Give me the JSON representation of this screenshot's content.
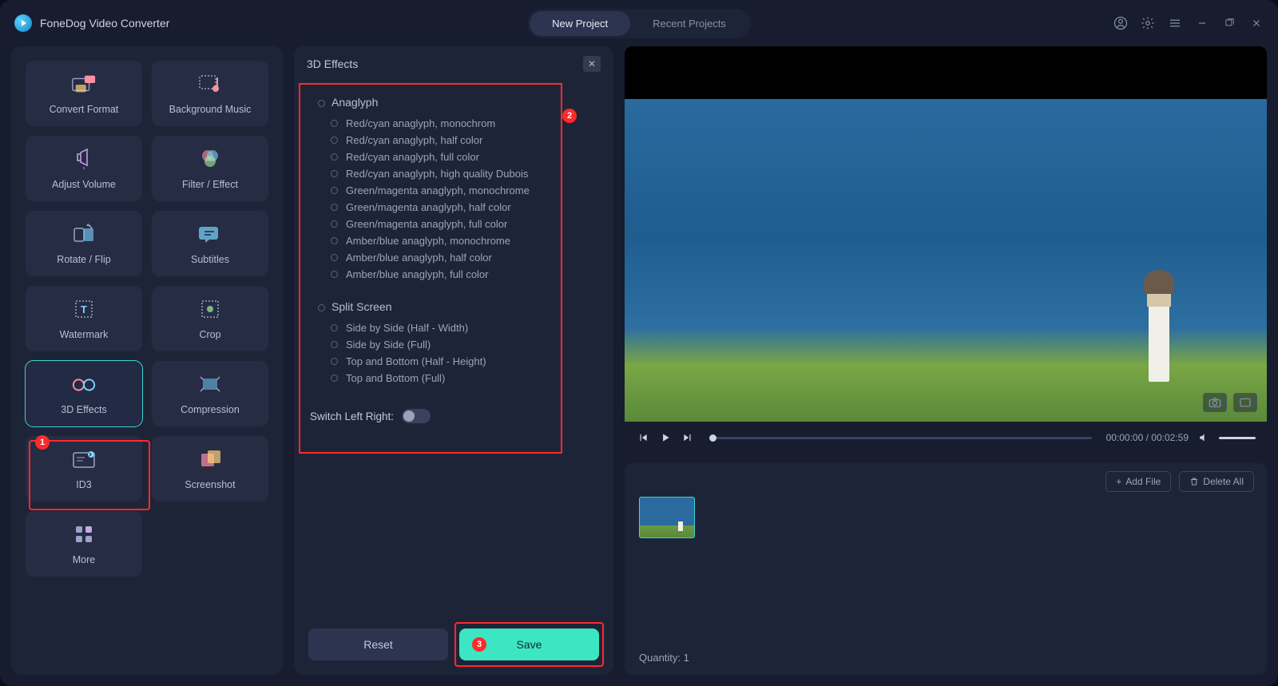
{
  "app_title": "FoneDog Video Converter",
  "tabs": {
    "new_project": "New Project",
    "recent_projects": "Recent Projects"
  },
  "tools": [
    {
      "id": "convert-format",
      "label": "Convert Format"
    },
    {
      "id": "background-music",
      "label": "Background Music"
    },
    {
      "id": "adjust-volume",
      "label": "Adjust Volume"
    },
    {
      "id": "filter-effect",
      "label": "Filter / Effect"
    },
    {
      "id": "rotate-flip",
      "label": "Rotate / Flip"
    },
    {
      "id": "subtitles",
      "label": "Subtitles"
    },
    {
      "id": "watermark",
      "label": "Watermark"
    },
    {
      "id": "crop",
      "label": "Crop"
    },
    {
      "id": "3d-effects",
      "label": "3D Effects"
    },
    {
      "id": "compression",
      "label": "Compression"
    },
    {
      "id": "id3",
      "label": "ID3"
    },
    {
      "id": "screenshot",
      "label": "Screenshot"
    },
    {
      "id": "more",
      "label": "More"
    }
  ],
  "panel": {
    "title": "3D Effects",
    "anaglyph_title": "Anaglyph",
    "anaglyph_options": [
      "Red/cyan anaglyph, monochrom",
      "Red/cyan anaglyph, half color",
      "Red/cyan anaglyph, full color",
      "Red/cyan anaglyph, high quality Dubois",
      "Green/magenta anaglyph, monochrome",
      "Green/magenta anaglyph, half color",
      "Green/magenta anaglyph, full color",
      "Amber/blue anaglyph, monochrome",
      "Amber/blue anaglyph, half color",
      "Amber/blue anaglyph, full color"
    ],
    "split_title": "Split Screen",
    "split_options": [
      "Side by Side (Half - Width)",
      "Side by Side (Full)",
      "Top and Bottom (Half - Height)",
      "Top and Bottom (Full)"
    ],
    "switch_label": "Switch Left Right:",
    "reset": "Reset",
    "save": "Save"
  },
  "player": {
    "time": "00:00:00 / 00:02:59"
  },
  "strip": {
    "add_file": "Add File",
    "delete_all": "Delete All",
    "quantity_label": "Quantity:",
    "quantity_value": "1"
  },
  "annotations": {
    "b1": "1",
    "b2": "2",
    "b3": "3"
  }
}
